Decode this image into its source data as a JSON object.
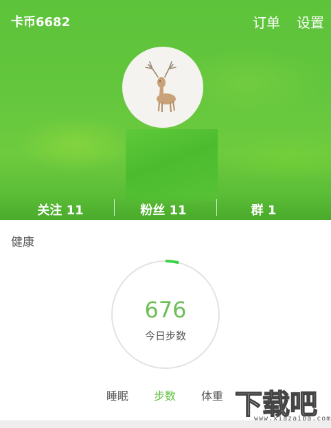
{
  "header": {
    "coins": "卡币6682",
    "orders_label": "订单",
    "settings_label": "设置",
    "avatar_icon": "deer-avatar"
  },
  "stats": {
    "follow": "关注 11",
    "fans": "粉丝 11",
    "groups": "群 1"
  },
  "health": {
    "section_label": "健康",
    "steps_value": "676",
    "steps_caption": "今日步数",
    "progress_fraction": 0.04,
    "accent_color": "#3fd14a"
  },
  "tabs": [
    {
      "label": "睡眠",
      "active": false
    },
    {
      "label": "步数",
      "active": true
    },
    {
      "label": "体重",
      "active": false
    }
  ],
  "watermark": {
    "text": "下载吧",
    "url": "www.xiazaiba.com"
  },
  "colors": {
    "brand_green": "#5dc33a",
    "active_tab": "#5cbf3c",
    "steps_text": "#6bbf55"
  }
}
